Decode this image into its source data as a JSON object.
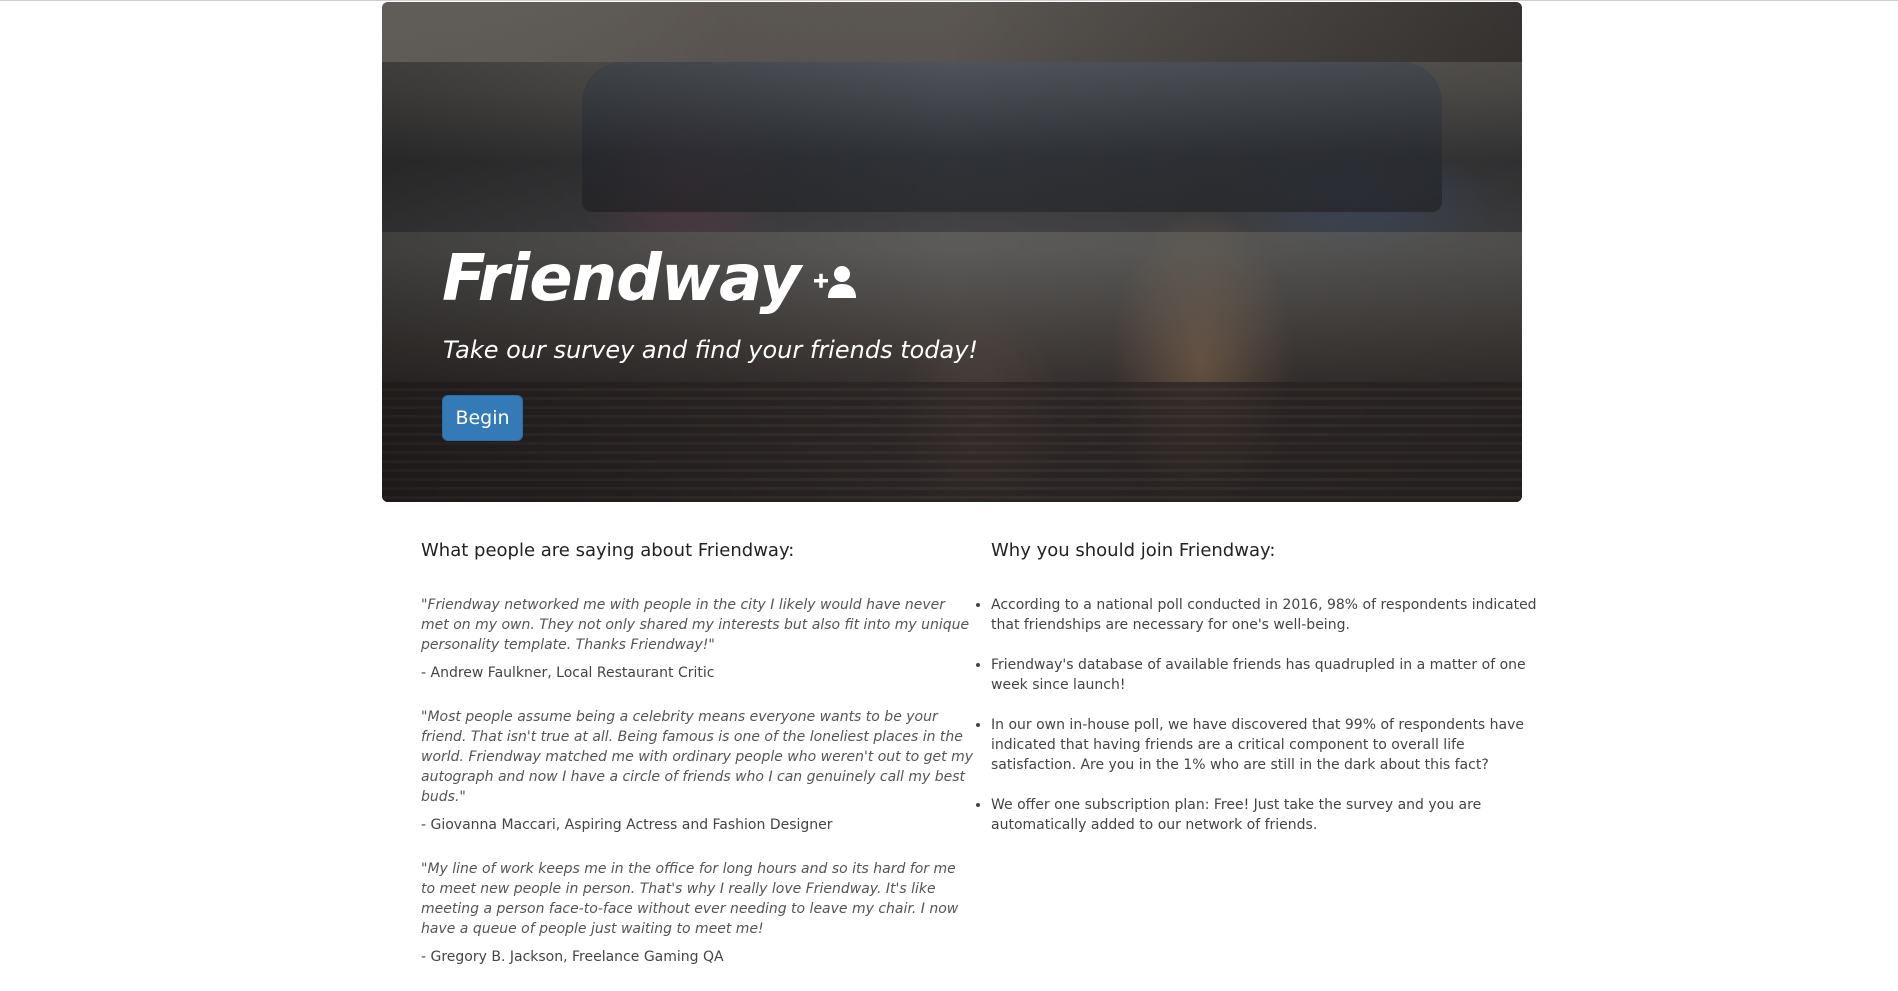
{
  "hero": {
    "title": "Friendway",
    "tagline": "Take our survey and find your friends today!",
    "begin_label": "Begin",
    "icon": "add-user-icon"
  },
  "testimonials": {
    "heading": "What people are saying about Friendway:",
    "items": [
      {
        "quote": "\"Friendway networked me with people in the city I likely would have never met on my own. They not only shared my interests but also fit into my unique personality template. Thanks Friendway!\"",
        "author": "- Andrew Faulkner, Local Restaurant Critic"
      },
      {
        "quote": "\"Most people assume being a celebrity means everyone wants to be your friend. That isn't true at all. Being famous is one of the loneliest places in the world. Friendway matched me with ordinary people who weren't out to get my autograph and now I have a circle of friends who I can genuinely call my best buds.\"",
        "author": "- Giovanna Maccari, Aspiring Actress and Fashion Designer"
      },
      {
        "quote": "\"My line of work keeps me in the office for long hours and so its hard for me to meet new people in person. That's why I really love Friendway. It's like meeting a person face-to-face without ever needing to leave my chair. I now have a queue of people just waiting to meet me!",
        "author": "- Gregory B. Jackson, Freelance Gaming QA"
      }
    ]
  },
  "reasons": {
    "heading": "Why you should join Friendway:",
    "items": [
      "According to a national poll conducted in 2016, 98% of respondents indicated that friendships are necessary for one's well-being.",
      "Friendway's database of available friends has quadrupled in a matter of one week since launch!",
      "In our own in-house poll, we have discovered that 99% of respondents have indicated that having friends are a critical component to overall life satisfaction. Are you in the 1% who are still in the dark about this fact?",
      "We offer one subscription plan: Free! Just take the survey and you are automatically added to our network of friends."
    ]
  },
  "colors": {
    "primary_button": "#337ab7",
    "text": "#333333"
  }
}
